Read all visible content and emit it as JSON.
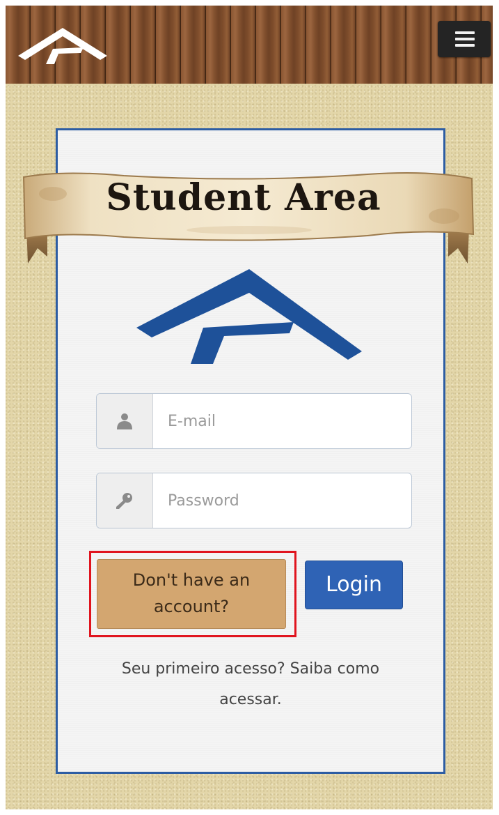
{
  "header": {
    "logo_icon": "roof-arch-logo",
    "menu_icon": "hamburger-menu-icon"
  },
  "banner": {
    "title": "Student Area"
  },
  "form": {
    "email": {
      "placeholder": "E-mail",
      "value": "",
      "icon": "user-icon"
    },
    "password": {
      "placeholder": "Password",
      "value": "",
      "icon": "key-icon"
    },
    "signup_label": "Don't have an account?",
    "login_label": "Login",
    "first_access_text": "Seu primeiro acesso? Saiba como acessar."
  },
  "colors": {
    "brand_blue": "#2f63b5",
    "logo_blue": "#1e5199",
    "signup_tan": "#d3a670",
    "highlight_red": "#e0141e",
    "sand_background": "#e3d6a9",
    "wood_header": "#7a4a2a"
  }
}
